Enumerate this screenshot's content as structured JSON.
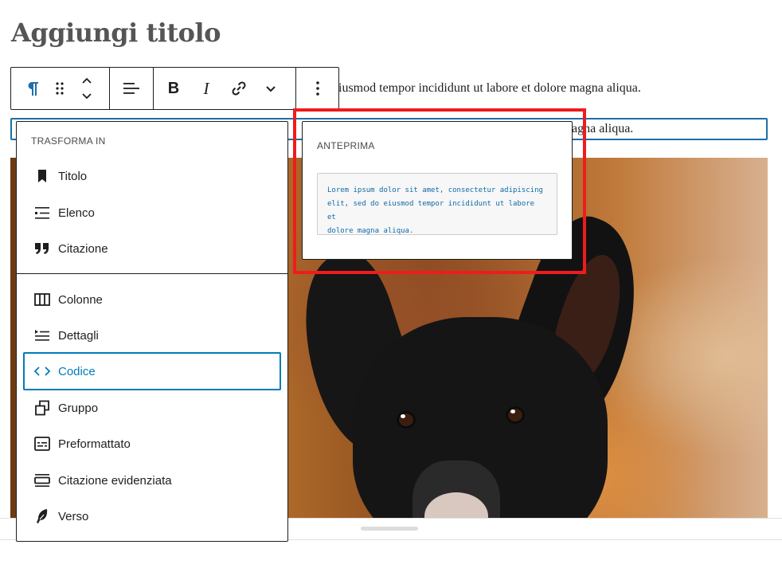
{
  "post": {
    "title": "Aggiungi titolo",
    "paragraph_1_visible": "iusmod tempor incididunt ut labore et dolore magna aliqua.",
    "paragraph_2_visible": "agna aliqua."
  },
  "toolbar": {
    "block_type_icon": "pilcrow-icon",
    "drag_icon": "drag-handle-icon",
    "move_icon": "chevron-up-down-icon",
    "align_icon": "align-left-icon",
    "bold_label": "B",
    "italic_label": "I",
    "link_icon": "link-icon",
    "more_formatting_icon": "chevron-down-icon",
    "options_icon": "more-vertical-icon"
  },
  "transform_menu": {
    "heading": "TRASFORMA IN",
    "items": [
      {
        "label": "Titolo",
        "icon": "bookmark-icon"
      },
      {
        "label": "Elenco",
        "icon": "list-icon"
      },
      {
        "label": "Citazione",
        "icon": "quote-icon"
      },
      {
        "label": "Colonne",
        "icon": "columns-icon"
      },
      {
        "label": "Dettagli",
        "icon": "details-icon"
      },
      {
        "label": "Codice",
        "icon": "code-icon",
        "selected": true
      },
      {
        "label": "Gruppo",
        "icon": "group-icon"
      },
      {
        "label": "Preformattato",
        "icon": "preformatted-icon"
      },
      {
        "label": "Citazione evidenziata",
        "icon": "pullquote-icon"
      },
      {
        "label": "Verso",
        "icon": "feather-icon"
      }
    ]
  },
  "preview": {
    "heading": "ANTEPRIMA",
    "code_line_1": "Lorem ipsum dolor sit amet, consectetur adipiscing",
    "code_line_2": "elit, sed do eiusmod tempor incididunt ut labore et",
    "code_line_3": "dolore magna aliqua."
  },
  "colors": {
    "accent": "#007cba",
    "highlight": "#ee1c1c",
    "code_text": "#0f6aa8"
  }
}
